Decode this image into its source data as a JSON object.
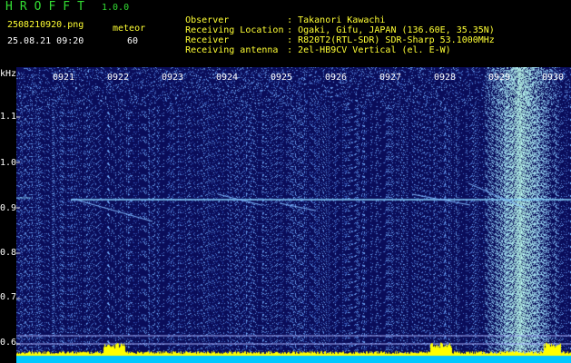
{
  "header": {
    "logo": "HROFFT",
    "version": "1.0.0",
    "filename": "2508210920.png",
    "mode": "meteor",
    "timestamp": "25.08.21 09:20",
    "count": "60",
    "info": [
      {
        "key": "Observer",
        "value": "Takanori Kawachi"
      },
      {
        "key": "Receiving Location",
        "value": "Ogaki, Gifu, JAPAN (136.60E, 35.35N)"
      },
      {
        "key": "Receiver",
        "value": "R820T2(RTL-SDR) SDR-Sharp 53.1000MHz"
      },
      {
        "key": "Receiving antenna",
        "value": "2el-HB9CV Vertical (el. E-W)"
      }
    ]
  },
  "spectrogram": {
    "y_unit": "kHz",
    "y_ticks": [
      "1.1",
      "1.0",
      "0.9",
      "0.8",
      "0.7",
      "0.6"
    ],
    "x_ticks": [
      "0921",
      "0922",
      "0923",
      "0924",
      "0925",
      "0926",
      "0927",
      "0928",
      "0929",
      "0930"
    ],
    "colors": {
      "background": "#0a0d5a",
      "carrier": "#88d6ff",
      "noise_band": "#6a9cff",
      "activity_bar": "#ffff00",
      "activity_base": "#00c8ff",
      "tick": "#ffffff"
    }
  }
}
